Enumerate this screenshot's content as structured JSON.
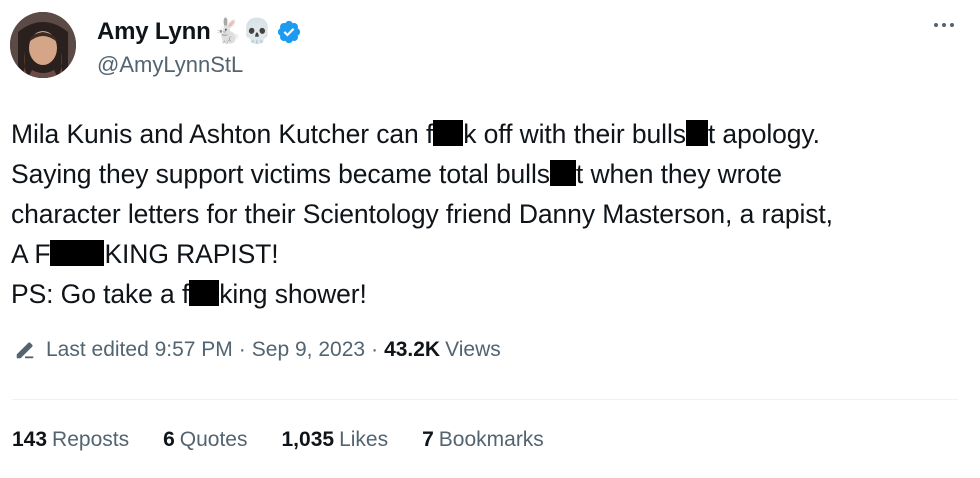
{
  "author": {
    "display_name": "Amy Lynn",
    "name_emojis": "🐇💀",
    "handle": "@AmyLynnStL",
    "verified_color": "#1d9bf0"
  },
  "tweet": {
    "lines": [
      [
        "Mila Kunis and Ashton Kutcher can f",
        "k off with their bulls",
        "t apology."
      ],
      [
        "Saying they support victims became total bulls",
        "t when they wrote"
      ],
      [
        "character letters for their Scientology friend Danny Masterson, a rapist,"
      ],
      [
        "A F",
        "KING RAPIST!"
      ],
      [
        "PS: Go take a f",
        "king shower!"
      ]
    ]
  },
  "meta": {
    "edited_label": "Last edited 9:57 PM",
    "separator": "·",
    "date": "Sep 9, 2023",
    "views_count": "43.2K",
    "views_label": "Views"
  },
  "stats": {
    "reposts": {
      "count": "143",
      "label": "Reposts"
    },
    "quotes": {
      "count": "6",
      "label": "Quotes"
    },
    "likes": {
      "count": "1,035",
      "label": "Likes"
    },
    "bookmarks": {
      "count": "7",
      "label": "Bookmarks"
    }
  }
}
